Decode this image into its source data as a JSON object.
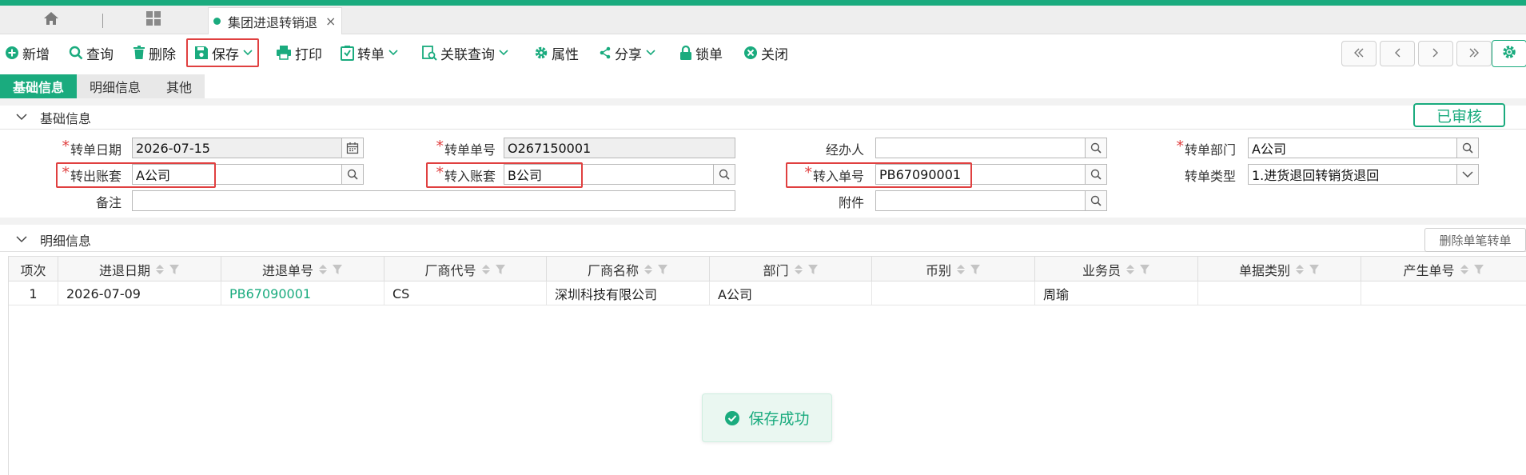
{
  "tabs": {
    "active_label": "集团进退转销退",
    "close_glyph": "×"
  },
  "toolbar": {
    "new": "新增",
    "query": "查询",
    "delete": "删除",
    "save": "保存",
    "print": "打印",
    "transfer": "转单",
    "related_query": "关联查询",
    "properties": "属性",
    "share": "分享",
    "lock": "锁单",
    "close": "关闭"
  },
  "subtabs": [
    "基础信息",
    "明细信息",
    "其他"
  ],
  "basic_section": {
    "title": "基础信息",
    "status_badge": "已审核"
  },
  "form": {
    "transfer_date": {
      "label": "转单日期",
      "value": "2026-07-15"
    },
    "transfer_no": {
      "label": "转单单号",
      "value": "O267150001"
    },
    "handler": {
      "label": "经办人",
      "value": ""
    },
    "transfer_dept": {
      "label": "转单部门",
      "value": "A公司"
    },
    "out_account": {
      "label": "转出账套",
      "value": "A公司"
    },
    "in_account": {
      "label": "转入账套",
      "value": "B公司"
    },
    "in_no": {
      "label": "转入单号",
      "value": "PB67090001"
    },
    "transfer_type": {
      "label": "转单类型",
      "value": "1.进货退回转销货退回"
    },
    "remark": {
      "label": "备注",
      "value": ""
    },
    "attachment": {
      "label": "附件",
      "value": ""
    },
    "required_mark": "*"
  },
  "detail_section": {
    "title": "明细信息",
    "delete_single": "删除单笔转单"
  },
  "grid": {
    "columns": [
      "项次",
      "进退日期",
      "进退单号",
      "厂商代号",
      "厂商名称",
      "部门",
      "币别",
      "业务员",
      "单据类别",
      "产生单号"
    ],
    "rows": [
      [
        "1",
        "2026-07-09",
        "PB67090001",
        "CS",
        "深圳科技有限公司",
        "A公司",
        "",
        "周瑜",
        "",
        ""
      ]
    ]
  },
  "toast": {
    "message": "保存成功"
  },
  "colors": {
    "accent": "#1aab7e",
    "highlight_red": "#e04040"
  }
}
